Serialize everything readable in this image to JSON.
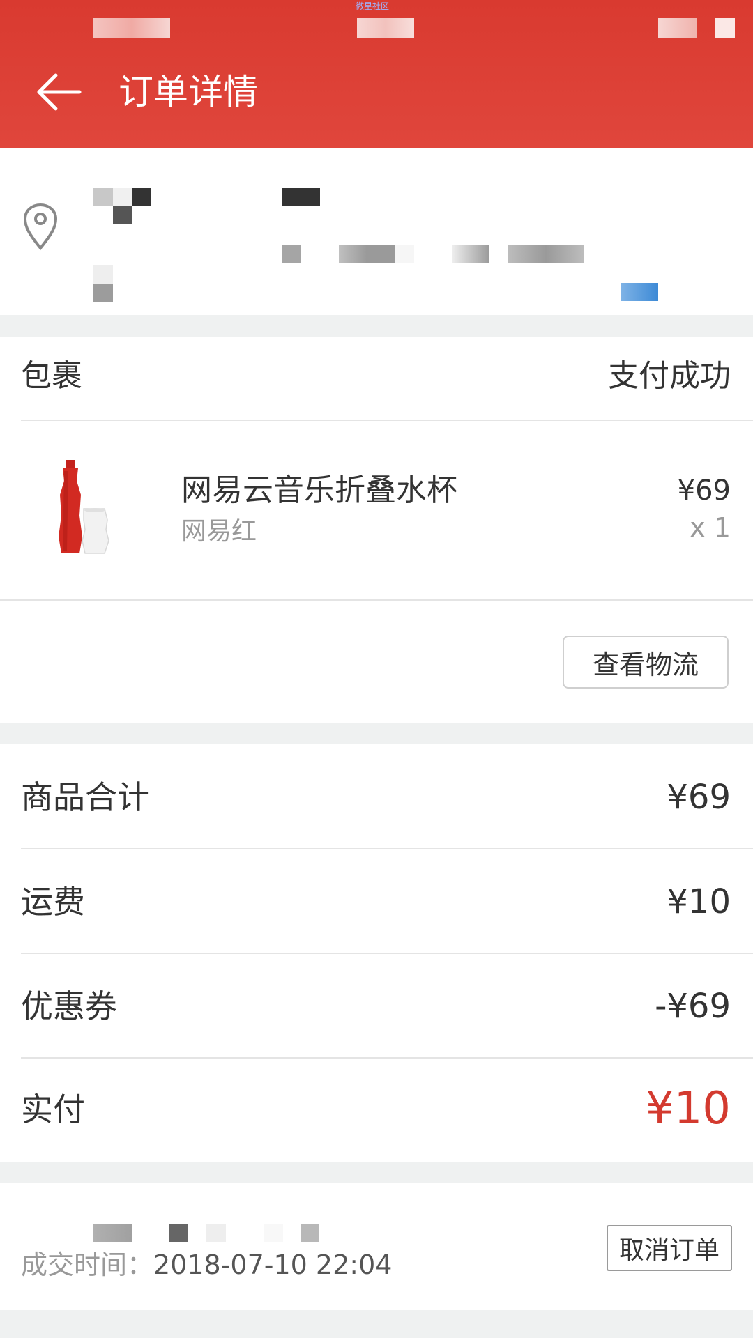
{
  "status_bar": {
    "tiny_text": "微星社区"
  },
  "header": {
    "title": "订单详情",
    "back_icon": "arrow-left-icon"
  },
  "address": {
    "icon": "location-pin-icon"
  },
  "package": {
    "label": "包裹",
    "status": "支付成功",
    "product": {
      "name": "网易云音乐折叠水杯",
      "spec": "网易红",
      "price": "¥69",
      "qty": "x 1"
    },
    "logistics_button": "查看物流"
  },
  "summary": {
    "rows": [
      {
        "label": "商品合计",
        "value": "¥69"
      },
      {
        "label": "运费",
        "value": "¥10"
      },
      {
        "label": "优惠券",
        "value": "-¥69"
      }
    ],
    "paid_label": "实付",
    "paid_value": "¥10",
    "accent": "#d33a2f"
  },
  "bottom": {
    "time_label": "成交时间：",
    "time_value": "2018-07-10 22:04",
    "cancel_button": "取消订单"
  },
  "colors": {
    "header": "#d93a30",
    "background": "#eff1f1"
  }
}
